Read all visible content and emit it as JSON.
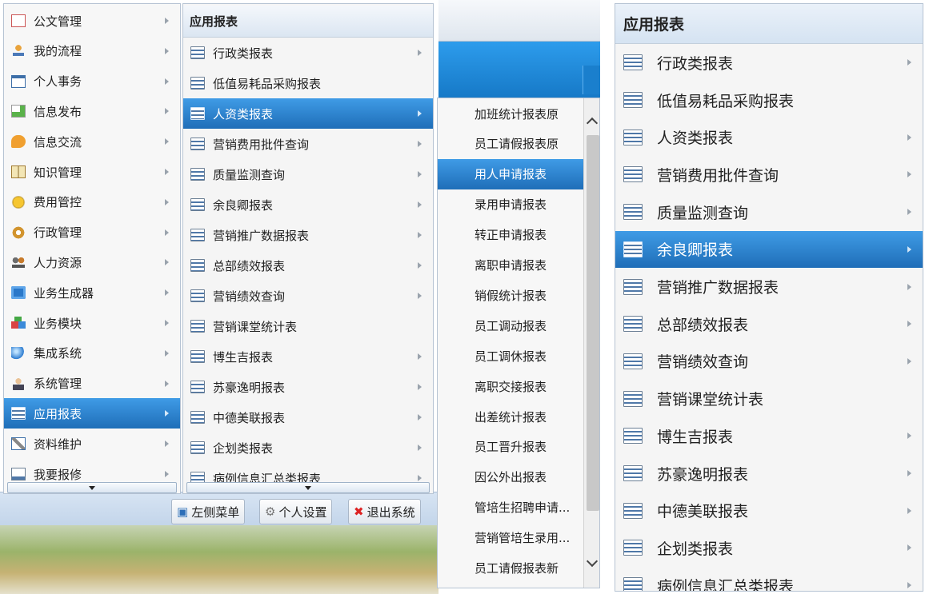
{
  "main_menu": {
    "items": [
      {
        "label": "公文管理",
        "icon": "document-icon"
      },
      {
        "label": "我的流程",
        "icon": "org-chart-icon"
      },
      {
        "label": "个人事务",
        "icon": "calendar-icon"
      },
      {
        "label": "信息发布",
        "icon": "publish-icon"
      },
      {
        "label": "信息交流",
        "icon": "chat-icon"
      },
      {
        "label": "知识管理",
        "icon": "book-icon"
      },
      {
        "label": "费用管控",
        "icon": "coins-icon"
      },
      {
        "label": "行政管理",
        "icon": "gear-icon"
      },
      {
        "label": "人力资源",
        "icon": "people-icon"
      },
      {
        "label": "业务生成器",
        "icon": "generator-icon"
      },
      {
        "label": "业务模块",
        "icon": "blocks-icon"
      },
      {
        "label": "集成系统",
        "icon": "globe-icon"
      },
      {
        "label": "系统管理",
        "icon": "admin-icon"
      },
      {
        "label": "应用报表",
        "icon": "report-list-icon",
        "selected": true
      },
      {
        "label": "资料维护",
        "icon": "wrench-icon"
      },
      {
        "label": "我要报修",
        "icon": "repair-icon"
      }
    ]
  },
  "report_menu": {
    "header": "应用报表",
    "items": [
      {
        "label": "行政类报表",
        "submenu": true
      },
      {
        "label": "低值易耗品采购报表",
        "submenu": false
      },
      {
        "label": "人资类报表",
        "submenu": true
      },
      {
        "label": "营销费用批件查询",
        "submenu": true
      },
      {
        "label": "质量监测查询",
        "submenu": true
      },
      {
        "label": "余良卿报表",
        "submenu": true
      },
      {
        "label": "营销推广数据报表",
        "submenu": true
      },
      {
        "label": "总部绩效报表",
        "submenu": true
      },
      {
        "label": "营销绩效查询",
        "submenu": true
      },
      {
        "label": "营销课堂统计表",
        "submenu": false
      },
      {
        "label": "博生吉报表",
        "submenu": true
      },
      {
        "label": "苏豪逸明报表",
        "submenu": true
      },
      {
        "label": "中德美联报表",
        "submenu": true
      },
      {
        "label": "企划类报表",
        "submenu": true
      },
      {
        "label": "病例信息汇总类报表",
        "submenu": true
      }
    ],
    "left_selected_index": 2,
    "right_selected_index": 5
  },
  "hr_submenu": {
    "items": [
      "加班统计报表原",
      "员工请假报表原",
      "用人申请报表",
      "录用申请报表",
      "转正申请报表",
      "离职申请报表",
      "销假统计报表",
      "员工调动报表",
      "员工调休报表",
      "离职交接报表",
      "出差统计报表",
      "员工晋升报表",
      "因公外出报表",
      "管培生招聘申请...",
      "营销管培生录用...",
      "员工请假报表新"
    ],
    "selected_index": 2
  },
  "toolbar": {
    "left_menu": "左侧菜单",
    "personal_settings": "个人设置",
    "exit_system": "退出系统"
  },
  "colors": {
    "selection": "#2b7fd0",
    "header_bg": "#dbe8f6",
    "blue_band": "#1d8fe0"
  }
}
